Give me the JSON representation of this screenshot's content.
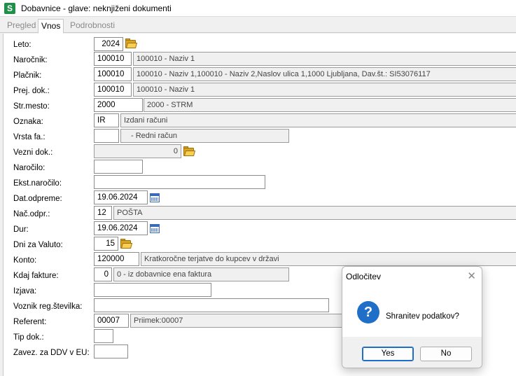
{
  "window": {
    "title": "Dobavnice - glave: neknjiženi dokumenti",
    "app_icon": "S"
  },
  "tabs": [
    "Pregled",
    "Vnos",
    "Podrobnosti"
  ],
  "form": {
    "leto": {
      "label": "Leto:",
      "value": "2024"
    },
    "narocnik": {
      "label": "Naročnik:",
      "code": "100010",
      "desc": "100010 - Naziv 1"
    },
    "placnik": {
      "label": "Plačnik:",
      "code": "100010",
      "desc": "100010 - Naziv 1,100010 - Naziv 2,Naslov ulica 1,1000 Ljubljana, Dav.št.: SI53076117"
    },
    "prej_dok": {
      "label": "Prej. dok.:",
      "code": "100010",
      "desc": "100010 - Naziv 1"
    },
    "str_mesto": {
      "label": "Str.mesto:",
      "code": "2000",
      "desc": "2000 - STRM"
    },
    "oznaka": {
      "label": "Oznaka:",
      "code": "IR",
      "desc": "Izdani računi"
    },
    "vrsta_fa": {
      "label": "Vrsta fa.:",
      "code": "",
      "desc": "- Redni račun"
    },
    "vezni_dok": {
      "label": "Vezni dok.:",
      "value": "0"
    },
    "narocilo": {
      "label": "Naročilo:",
      "value": ""
    },
    "ekst_narocilo": {
      "label": "Ekst.naročilo:",
      "value": ""
    },
    "dat_odpreme": {
      "label": "Dat.odpreme:",
      "value": "19.06.2024"
    },
    "nac_odpr": {
      "label": "Nač.odpr.:",
      "code": "12",
      "desc": "POŠTA"
    },
    "dur": {
      "label": "Dur:",
      "value": "19.06.2024"
    },
    "dni_za_valuto": {
      "label": "Dni za Valuto:",
      "value": "15"
    },
    "konto": {
      "label": "Konto:",
      "code": "120000",
      "desc": "Kratkoročne terjatve do kupcev v državi"
    },
    "kdaj_fakture": {
      "label": "Kdaj fakture:",
      "code": "0",
      "desc": "0 - iz dobavnice ena faktura"
    },
    "izjava": {
      "label": "Izjava:",
      "value": ""
    },
    "voznik": {
      "label": "Voznik reg.številka:",
      "value": ""
    },
    "referent": {
      "label": "Referent:",
      "code": "00007",
      "desc": "Priimek:00007"
    },
    "tip_dok": {
      "label": "Tip dok.:",
      "value": ""
    },
    "zavez_ddv": {
      "label": "Zavez. za DDV v EU:",
      "value": ""
    }
  },
  "dialog": {
    "title": "Odločitev",
    "message": "Shranitev podatkov?",
    "yes": "Yes",
    "no": "No",
    "close": "✕"
  }
}
